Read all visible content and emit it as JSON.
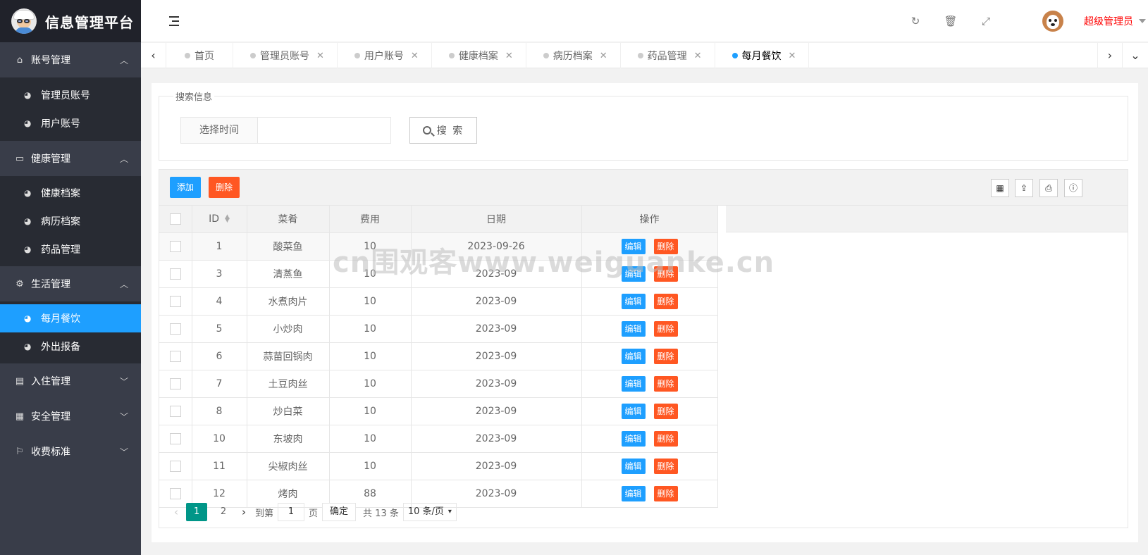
{
  "app": {
    "title": "信息管理平台"
  },
  "sidebar": {
    "groups": [
      {
        "label": "账号管理",
        "icon": "home-icon",
        "expanded": true,
        "items": [
          {
            "label": "管理员账号"
          },
          {
            "label": "用户账号"
          }
        ]
      },
      {
        "label": "健康管理",
        "icon": "window-icon",
        "expanded": true,
        "items": [
          {
            "label": "健康档案"
          },
          {
            "label": "病历档案"
          },
          {
            "label": "药品管理"
          }
        ]
      },
      {
        "label": "生活管理",
        "icon": "gears-icon",
        "expanded": true,
        "items": [
          {
            "label": "每月餐饮",
            "active": true
          },
          {
            "label": "外出报备"
          }
        ]
      },
      {
        "label": "入住管理",
        "icon": "file-icon",
        "expanded": false,
        "items": []
      },
      {
        "label": "安全管理",
        "icon": "calendar-icon",
        "expanded": false,
        "items": []
      },
      {
        "label": "收费标准",
        "icon": "flag-icon",
        "expanded": false,
        "items": []
      }
    ]
  },
  "header": {
    "user_name": "超级管理员"
  },
  "tabs": [
    {
      "label": "首页",
      "closable": false
    },
    {
      "label": "管理员账号",
      "closable": true
    },
    {
      "label": "用户账号",
      "closable": true
    },
    {
      "label": "健康档案",
      "closable": true
    },
    {
      "label": "病历档案",
      "closable": true
    },
    {
      "label": "药品管理",
      "closable": true
    },
    {
      "label": "每月餐饮",
      "closable": true,
      "active": true
    }
  ],
  "search": {
    "legend": "搜索信息",
    "date_label": "选择时间",
    "date_value": "",
    "button_label": "搜 索"
  },
  "toolbar": {
    "add_label": "添加",
    "delete_label": "删除"
  },
  "table": {
    "columns": [
      "ID",
      "菜肴",
      "费用",
      "日期",
      "操作"
    ],
    "edit_label": "编辑",
    "delete_label": "删除",
    "rows": [
      {
        "id": "1",
        "dish": "酸菜鱼",
        "cost": "10",
        "date": "2023-09-26"
      },
      {
        "id": "3",
        "dish": "清蒸鱼",
        "cost": "10",
        "date": "2023-09"
      },
      {
        "id": "4",
        "dish": "水煮肉片",
        "cost": "10",
        "date": "2023-09"
      },
      {
        "id": "5",
        "dish": "小炒肉",
        "cost": "10",
        "date": "2023-09"
      },
      {
        "id": "6",
        "dish": "蒜苗回锅肉",
        "cost": "10",
        "date": "2023-09"
      },
      {
        "id": "7",
        "dish": "土豆肉丝",
        "cost": "10",
        "date": "2023-09"
      },
      {
        "id": "8",
        "dish": "炒白菜",
        "cost": "10",
        "date": "2023-09"
      },
      {
        "id": "10",
        "dish": "东坡肉",
        "cost": "10",
        "date": "2023-09"
      },
      {
        "id": "11",
        "dish": "尖椒肉丝",
        "cost": "10",
        "date": "2023-09"
      },
      {
        "id": "12",
        "dish": "烤肉",
        "cost": "88",
        "date": "2023-09"
      }
    ]
  },
  "pager": {
    "pages": [
      "1",
      "2"
    ],
    "current": "1",
    "goto_label": "到第",
    "goto_value": "1",
    "page_unit": "页",
    "confirm_label": "确定",
    "total_label": "共 13 条",
    "page_size_label": "10 条/页"
  },
  "watermark": "cn围观客www.weiguanke.cn",
  "colors": {
    "accent": "#1e9fff",
    "danger": "#ff5722",
    "pager_active": "#009688",
    "sidebar": "#393d49",
    "user_name": "#ff0000"
  }
}
